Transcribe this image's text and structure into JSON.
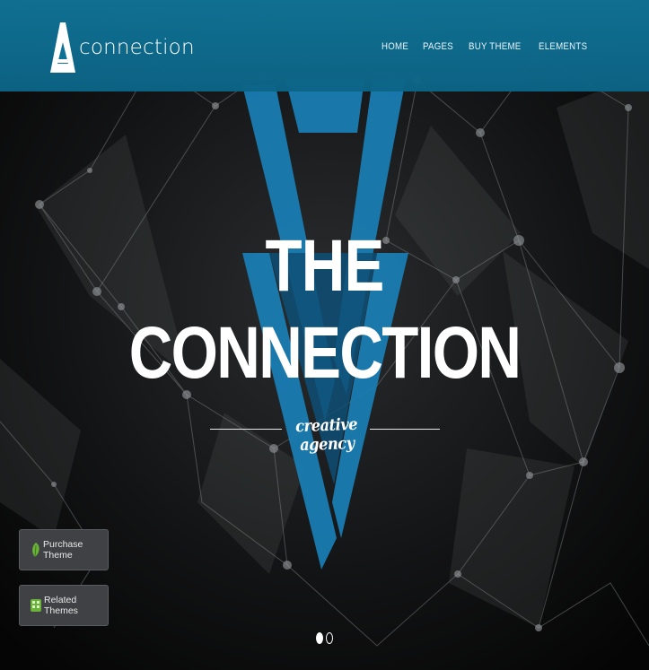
{
  "brand": {
    "name": "connection"
  },
  "nav": {
    "items": [
      {
        "label": "HOME"
      },
      {
        "label": "PAGES"
      },
      {
        "label": "BUY THEME"
      },
      {
        "label": "ELEMENTS"
      }
    ]
  },
  "hero": {
    "title_line1": "THE",
    "title_line2": "CONNECTION",
    "tagline": "creative agency"
  },
  "side_buttons": {
    "purchase": {
      "label": "Purchase Theme",
      "icon": "leaf-icon"
    },
    "related": {
      "label": "Related Themes",
      "icon": "grid-icon"
    }
  },
  "slider": {
    "slides": 2,
    "active": 1
  },
  "colors": {
    "header": "#0f7295",
    "accent_blue": "#1a7fb6",
    "background": "#050607",
    "button_bg": "#3f4144"
  }
}
